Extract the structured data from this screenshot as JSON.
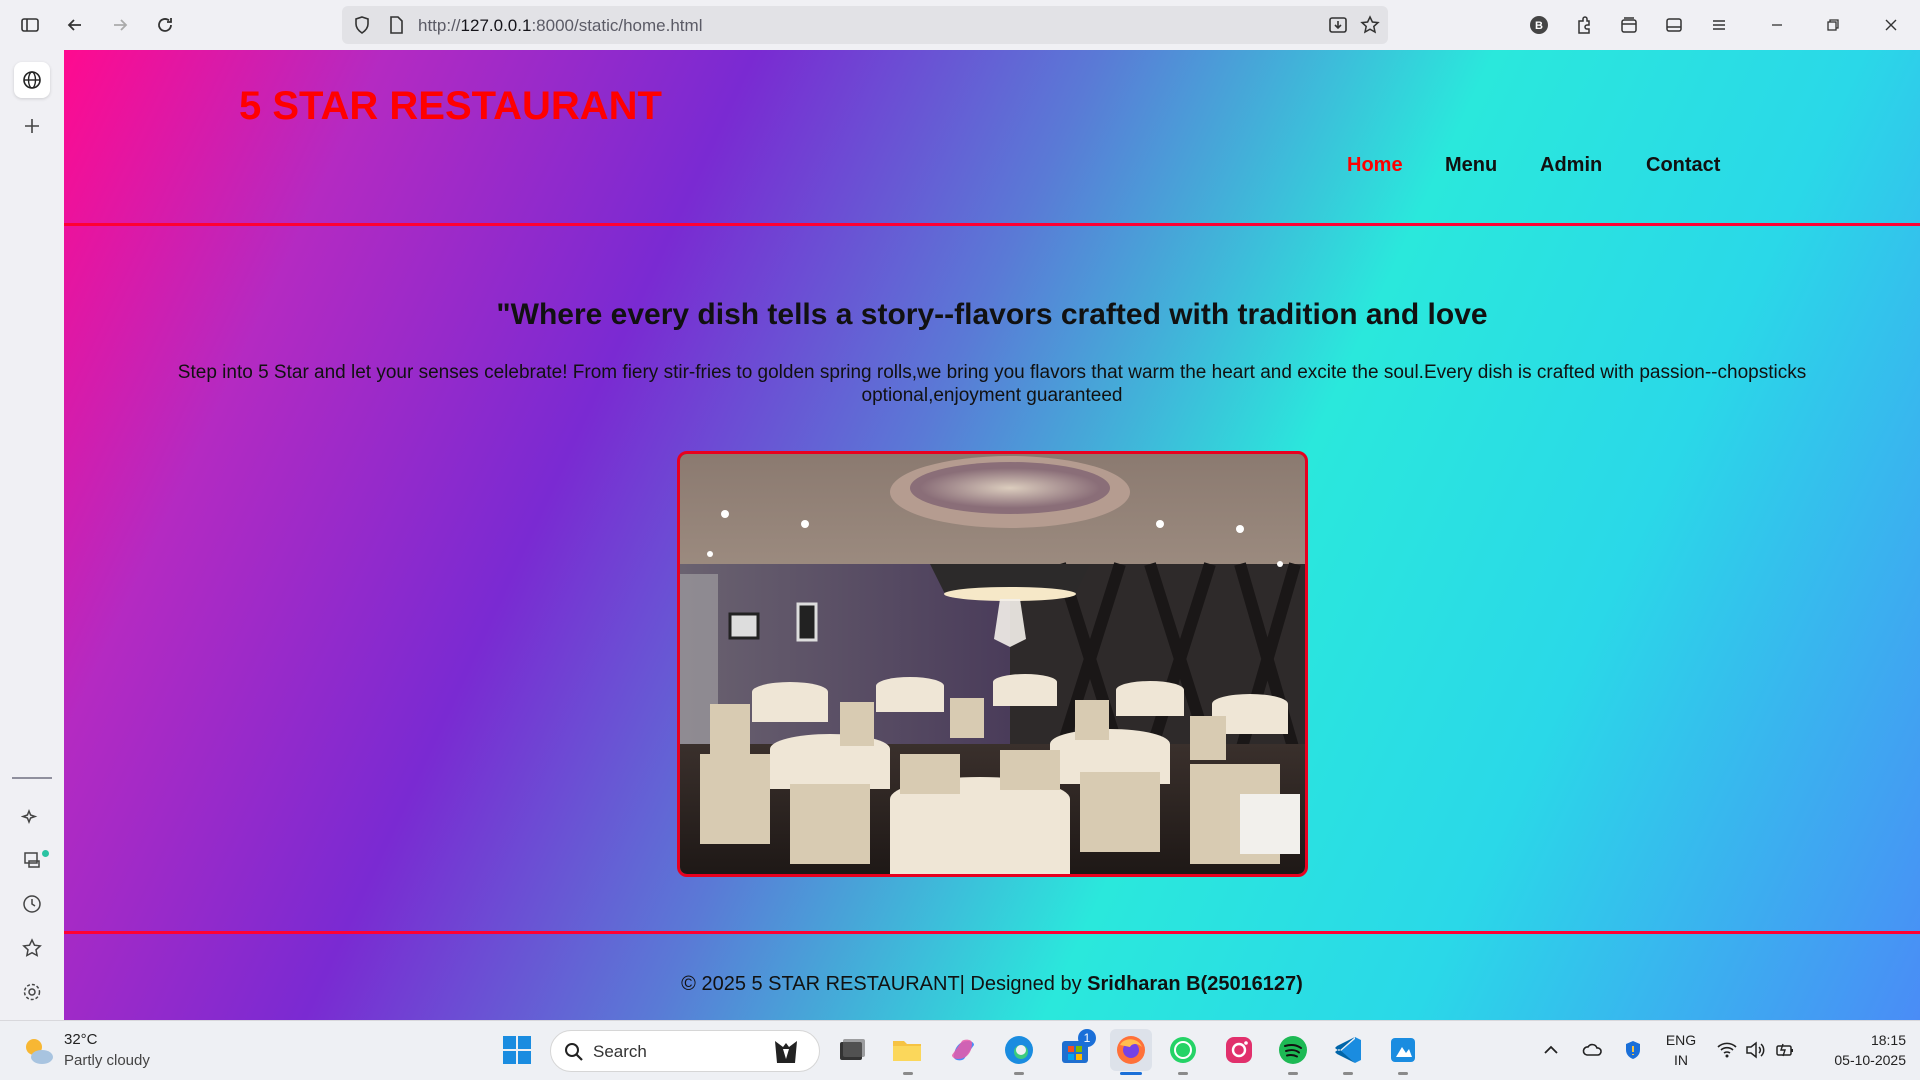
{
  "browser": {
    "url_prefix": "http://",
    "url_host": "127.0.0.1",
    "url_path": ":8000/static/home.html"
  },
  "site": {
    "logo": "5 STAR RESTAURANT",
    "nav": [
      {
        "label": "Home",
        "active": true
      },
      {
        "label": "Menu",
        "active": false
      },
      {
        "label": "Admin",
        "active": false
      },
      {
        "label": "Contact",
        "active": false
      }
    ],
    "hero_title": "\"Where every dish tells a story--flavors crafted with tradition and love",
    "hero_text": "Step into 5 Star and let your senses celebrate! From fiery stir-fries to golden spring rolls,we bring you flavors that warm the heart and excite the soul.Every dish is crafted with passion--chopsticks optional,enjoyment guaranteed",
    "footer_prefix": "© 2025 5 STAR RESTAURANT| Designed by ",
    "footer_author": "Sridharan B(25016127)"
  },
  "taskbar": {
    "temperature": "32°C",
    "weather": "Partly cloudy",
    "search_placeholder": "Search",
    "language": "ENG",
    "region": "IN",
    "time": "18:15",
    "date": "05-10-2025",
    "store_badge": "1"
  },
  "colors": {
    "accent_red": "#ff0000",
    "border_red": "#ff0033"
  }
}
